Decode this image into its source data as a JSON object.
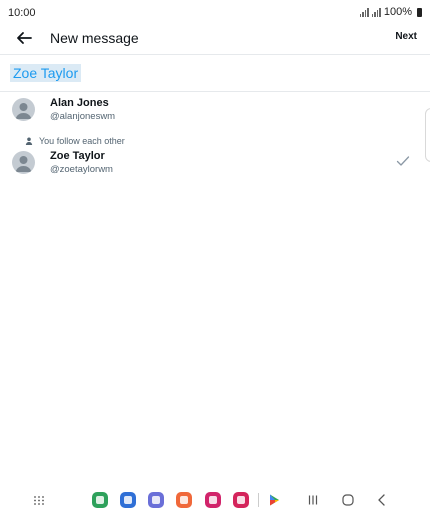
{
  "status_bar": {
    "time": "10:00",
    "battery": "100%"
  },
  "header": {
    "title": "New message",
    "next_label": "Next"
  },
  "search": {
    "query": "Zoe Taylor"
  },
  "contacts": [
    {
      "name": "Alan Jones",
      "handle": "@alanjoneswm",
      "selected": false
    },
    {
      "name": "Zoe Taylor",
      "handle": "@zoetaylorwm",
      "selected": true,
      "note": "You follow each other"
    }
  ],
  "nav_bar": {
    "apps": [
      {
        "icon": "phone-app-icon",
        "color": "#2ea15b"
      },
      {
        "icon": "messages-app-icon",
        "color": "#2f6fd6"
      },
      {
        "icon": "internet-app-icon",
        "color": "#6a6fd8"
      },
      {
        "icon": "notes-app-icon",
        "color": "#f0683a"
      },
      {
        "icon": "gallery-app-icon",
        "color": "#d1246b"
      },
      {
        "icon": "camera-app-icon",
        "color": "#d4245b"
      }
    ]
  },
  "colors": {
    "accent": "#1d9bf0",
    "chip_bg": "#dbeaf5",
    "text": "#0f1419",
    "secondary": "#536471"
  }
}
